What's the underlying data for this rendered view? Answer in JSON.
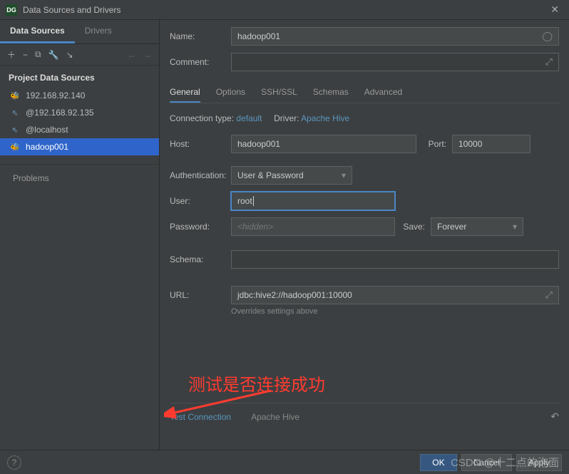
{
  "titlebar": {
    "title": "Data Sources and Drivers"
  },
  "leftTabs": {
    "dataSources": "Data Sources",
    "drivers": "Drivers"
  },
  "sectionTitle": "Project Data Sources",
  "dataSources": [
    {
      "label": "192.168.92.140",
      "icon": "bee"
    },
    {
      "label": "@192.168.92.135",
      "icon": "db"
    },
    {
      "label": "@localhost",
      "icon": "db"
    },
    {
      "label": "hadoop001",
      "icon": "bee"
    }
  ],
  "problemsLabel": "Problems",
  "form": {
    "nameLabel": "Name:",
    "nameValue": "hadoop001",
    "commentLabel": "Comment:",
    "tabs": {
      "general": "General",
      "options": "Options",
      "ssh": "SSH/SSL",
      "schemas": "Schemas",
      "advanced": "Advanced"
    },
    "connTypeLabel": "Connection type:",
    "connTypeValue": "default",
    "driverLabel": "Driver:",
    "driverValue": "Apache Hive",
    "hostLabel": "Host:",
    "hostValue": "hadoop001",
    "portLabel": "Port:",
    "portValue": "10000",
    "authLabel": "Authentication:",
    "authValue": "User & Password",
    "userLabel": "User:",
    "userValue": "root",
    "passLabel": "Password:",
    "passPlaceholder": "<hidden>",
    "saveLabel": "Save:",
    "saveValue": "Forever",
    "schemaLabel": "Schema:",
    "urlLabel": "URL:",
    "urlValue": "jdbc:hive2://hadoop001:10000",
    "urlNote": "Overrides settings above",
    "testConn": "Test Connection",
    "driverLink": "Apache Hive"
  },
  "annotation": "测试是否连接成功",
  "buttons": {
    "ok": "OK",
    "cancel": "Cancel",
    "apply": "Apply"
  },
  "watermark": "CSDN @十二点的泡面"
}
